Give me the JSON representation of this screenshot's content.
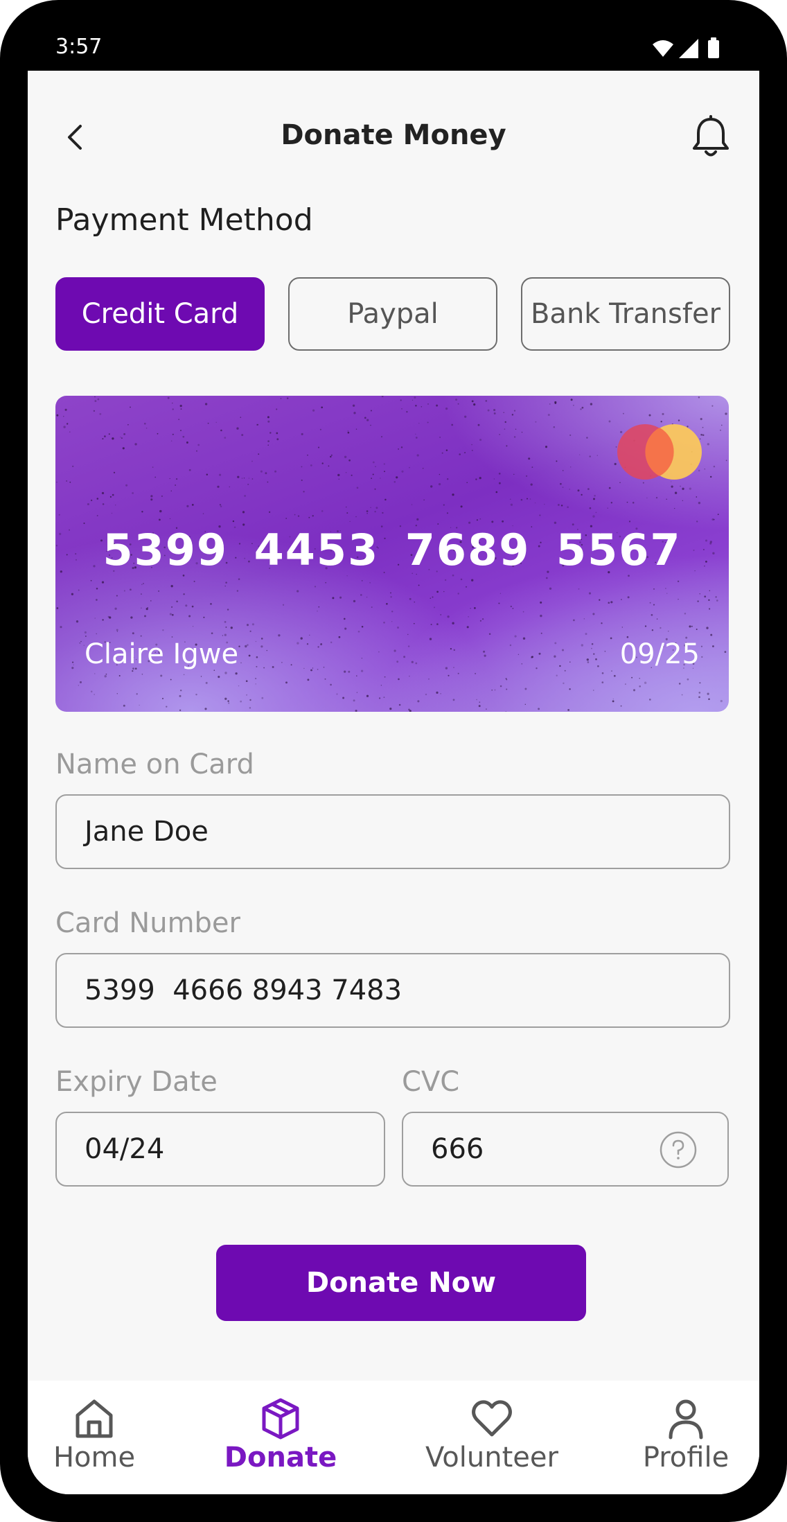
{
  "status_bar": {
    "time": "3:57"
  },
  "header": {
    "title": "Donate Money"
  },
  "payment": {
    "section_label": "Payment Method",
    "methods": [
      {
        "label": "Credit Card",
        "active": true
      },
      {
        "label": "Paypal",
        "active": false
      },
      {
        "label": "Bank Transfer",
        "active": false
      }
    ]
  },
  "card": {
    "number": "5399 4453 7689 5567",
    "holder": "Claire Igwe",
    "expiry": "09/25",
    "brand_icon": "mastercard-logo"
  },
  "form": {
    "name_label": "Name on Card",
    "name_value": "Jane Doe",
    "number_label": "Card Number",
    "number_value": "5399  4666 8943 7483",
    "expiry_label": "Expiry Date",
    "expiry_value": "04/24",
    "cvc_label": "CVC",
    "cvc_value": "666"
  },
  "actions": {
    "donate_label": "Donate Now"
  },
  "nav": {
    "items": [
      {
        "label": "Home",
        "icon": "home-icon",
        "active": false
      },
      {
        "label": "Donate",
        "icon": "box-icon",
        "active": true
      },
      {
        "label": "Volunteer",
        "icon": "heart-icon",
        "active": false
      },
      {
        "label": "Profile",
        "icon": "person-icon",
        "active": false
      }
    ]
  },
  "colors": {
    "accent": "#6e0ab1",
    "background": "#f7f7f7"
  }
}
